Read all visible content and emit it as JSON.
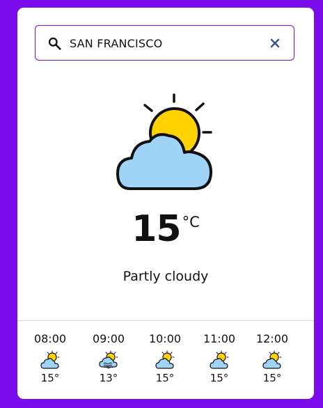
{
  "search": {
    "value": "SAN FRANCISCO",
    "placeholder": ""
  },
  "current": {
    "icon": "partly-cloudy-icon",
    "temperature": "15",
    "unit": "°C",
    "description": "Partly cloudy"
  },
  "hourly": [
    {
      "time": "08:00",
      "icon": "partly-cloudy-icon",
      "temp": "15°"
    },
    {
      "time": "09:00",
      "icon": "fog-icon",
      "temp": "13°"
    },
    {
      "time": "10:00",
      "icon": "partly-cloudy-icon",
      "temp": "15°"
    },
    {
      "time": "11:00",
      "icon": "partly-cloudy-icon",
      "temp": "15°"
    },
    {
      "time": "12:00",
      "icon": "partly-cloudy-icon",
      "temp": "15°"
    }
  ],
  "colors": {
    "background": "#7a0bea",
    "sun": "#ffd200",
    "cloud": "#9fd4f8",
    "clear_icon": "#3a5a8a"
  }
}
